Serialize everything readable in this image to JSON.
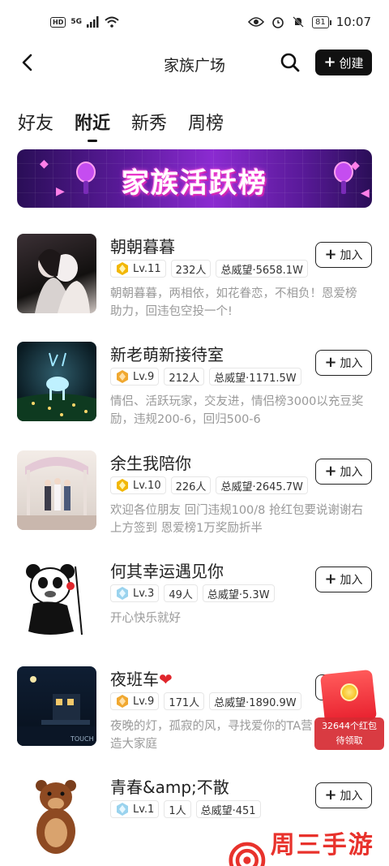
{
  "status_bar": {
    "hd": "HD",
    "signal": "5G",
    "time": "10:07",
    "battery": "81"
  },
  "header": {
    "title": "家族广场",
    "create_label": "创建"
  },
  "tabs": [
    {
      "label": "好友",
      "active": false
    },
    {
      "label": "附近",
      "active": true
    },
    {
      "label": "新秀",
      "active": false
    },
    {
      "label": "周榜",
      "active": false
    }
  ],
  "banner": {
    "text": "家族活跃榜"
  },
  "families": [
    {
      "name": "朝朝暮暮",
      "level": "Lv.11",
      "level_color": "#f2b705",
      "members": "232人",
      "prestige": "总威望·5658.1W",
      "desc": "朝朝暮暮，两相依，如花眷恋，不相负！恩爱榜助力，回违包空投一个!",
      "join_label": "加入"
    },
    {
      "name": "新老萌新接待室",
      "level": "Lv.9",
      "level_color": "#f0a830",
      "members": "212人",
      "prestige": "总威望·1171.5W",
      "desc": "情侣、活跃玩家，交友进，情侣榜3000以充豆奖励，违规200-6，回归500-6",
      "join_label": "加入"
    },
    {
      "name": "余生我陪你",
      "level": "Lv.10",
      "level_color": "#f2b705",
      "members": "226人",
      "prestige": "总威望·2645.7W",
      "desc": "欢迎各位朋友 回门违规100/8 抢红包要说谢谢右上方签到 恩爱榜1万奖励折半",
      "join_label": "加入"
    },
    {
      "name": "何其幸运遇见你",
      "level": "Lv.3",
      "level_color": "#9ad3ee",
      "members": "49人",
      "prestige": "总威望·5.3W",
      "desc": "开心快乐就好",
      "join_label": "加入"
    },
    {
      "name": "夜班车",
      "name_suffix": "❤",
      "level": "Lv.9",
      "level_color": "#f0a830",
      "members": "171人",
      "prestige": "总威望·1890.9W",
      "desc": "夜晚的灯，孤寂的风，寻找爱你的TA营造大家庭",
      "join_label": "加入"
    },
    {
      "name": "青春&amp;不散",
      "level": "Lv.1",
      "level_color": "#9ad3ee",
      "members": "1人",
      "prestige": "总威望·451",
      "desc": "",
      "join_label": "加入"
    }
  ],
  "red_packet": {
    "line1": "32644个红包",
    "line2": "待领取"
  },
  "watermark": {
    "text": "周三手游网"
  },
  "icons": {
    "back": "chevron-left-icon",
    "search": "search-icon",
    "plus": "plus-icon",
    "level": "diamond-icon"
  }
}
